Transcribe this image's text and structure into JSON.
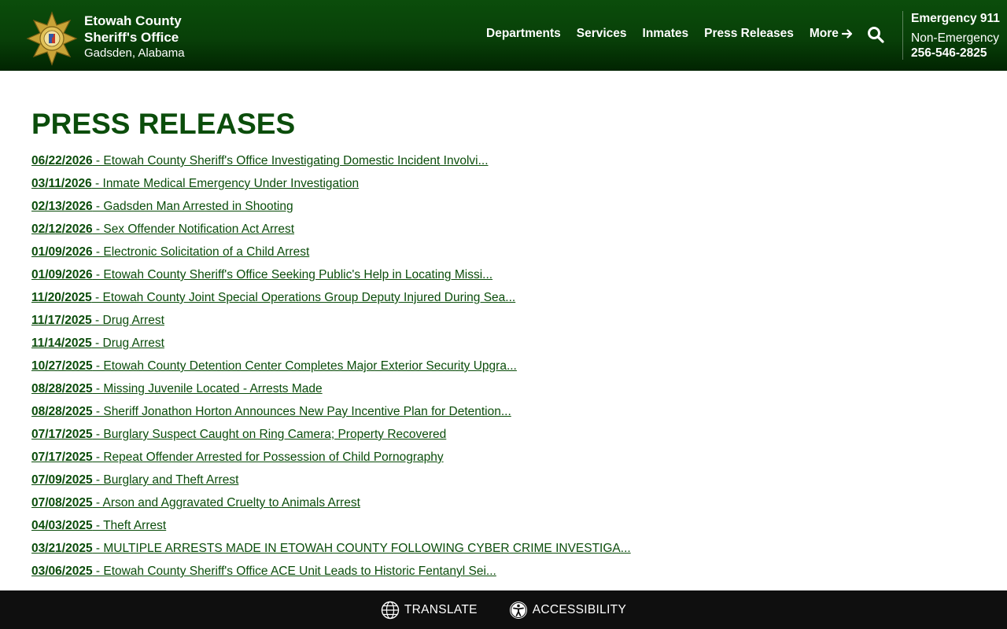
{
  "header": {
    "brand_line1": "Etowah County",
    "brand_line2": "Sheriff's Office",
    "brand_line3": "Gadsden, Alabama",
    "logo_icon": "sheriff-star-badge",
    "colors": {
      "header_green": "#0b4d0b",
      "header_dark": "#012401",
      "badge_gold": "#c9a437"
    }
  },
  "nav": {
    "items": [
      "Departments",
      "Services",
      "Inmates",
      "Press Releases"
    ],
    "more_label": "More",
    "more_icon": "arrow-right-icon",
    "search_icon": "search-icon"
  },
  "emergency": {
    "label": "Emergency 911",
    "non_emergency_label": "Non-Emergency",
    "phone": "256-546-2825"
  },
  "main": {
    "title": "PRESS RELEASES",
    "releases": [
      {
        "date": "06/22/2026",
        "title": " - Etowah County Sheriff's Office Investigating Domestic Incident Involvi..."
      },
      {
        "date": "03/11/2026",
        "title": " - Inmate Medical Emergency Under Investigation"
      },
      {
        "date": "02/13/2026",
        "title": " - Gadsden Man Arrested in Shooting"
      },
      {
        "date": "02/12/2026",
        "title": " - Sex Offender Notification Act Arrest"
      },
      {
        "date": "01/09/2026",
        "title": " - Electronic Solicitation of a Child Arrest"
      },
      {
        "date": "01/09/2026",
        "title": " - Etowah County Sheriff's Office Seeking Public's Help in Locating Missi..."
      },
      {
        "date": "11/20/2025",
        "title": " - Etowah County Joint Special Operations Group Deputy Injured During Sea..."
      },
      {
        "date": "11/17/2025",
        "title": " - Drug Arrest"
      },
      {
        "date": "11/14/2025",
        "title": " - Drug Arrest"
      },
      {
        "date": "10/27/2025",
        "title": " - Etowah County Detention Center Completes Major Exterior Security Upgra..."
      },
      {
        "date": "08/28/2025",
        "title": " - Missing Juvenile Located - Arrests Made"
      },
      {
        "date": "08/28/2025",
        "title": " - Sheriff Jonathon Horton Announces New Pay Incentive Plan for Detention..."
      },
      {
        "date": "07/17/2025",
        "title": " - Burglary Suspect Caught on Ring Camera; Property Recovered"
      },
      {
        "date": "07/17/2025",
        "title": " - Repeat Offender Arrested for Possession of Child Pornography"
      },
      {
        "date": "07/09/2025",
        "title": " - Burglary and Theft Arrest"
      },
      {
        "date": "07/08/2025",
        "title": " - Arson and Aggravated Cruelty to Animals Arrest"
      },
      {
        "date": "04/03/2025",
        "title": " - Theft Arrest"
      },
      {
        "date": "03/21/2025",
        "title": " - MULTIPLE ARRESTS MADE IN ETOWAH COUNTY FOLLOWING CYBER CRIME INVESTIGA..."
      },
      {
        "date": "03/06/2025",
        "title": " - Etowah County Sheriff's Office ACE Unit Leads to Historic Fentanyl Sei..."
      }
    ]
  },
  "footer_bar": {
    "translate_label": "TRANSLATE",
    "translate_icon": "globe-icon",
    "accessibility_label": "ACCESSIBILITY",
    "accessibility_icon": "accessibility-icon"
  }
}
